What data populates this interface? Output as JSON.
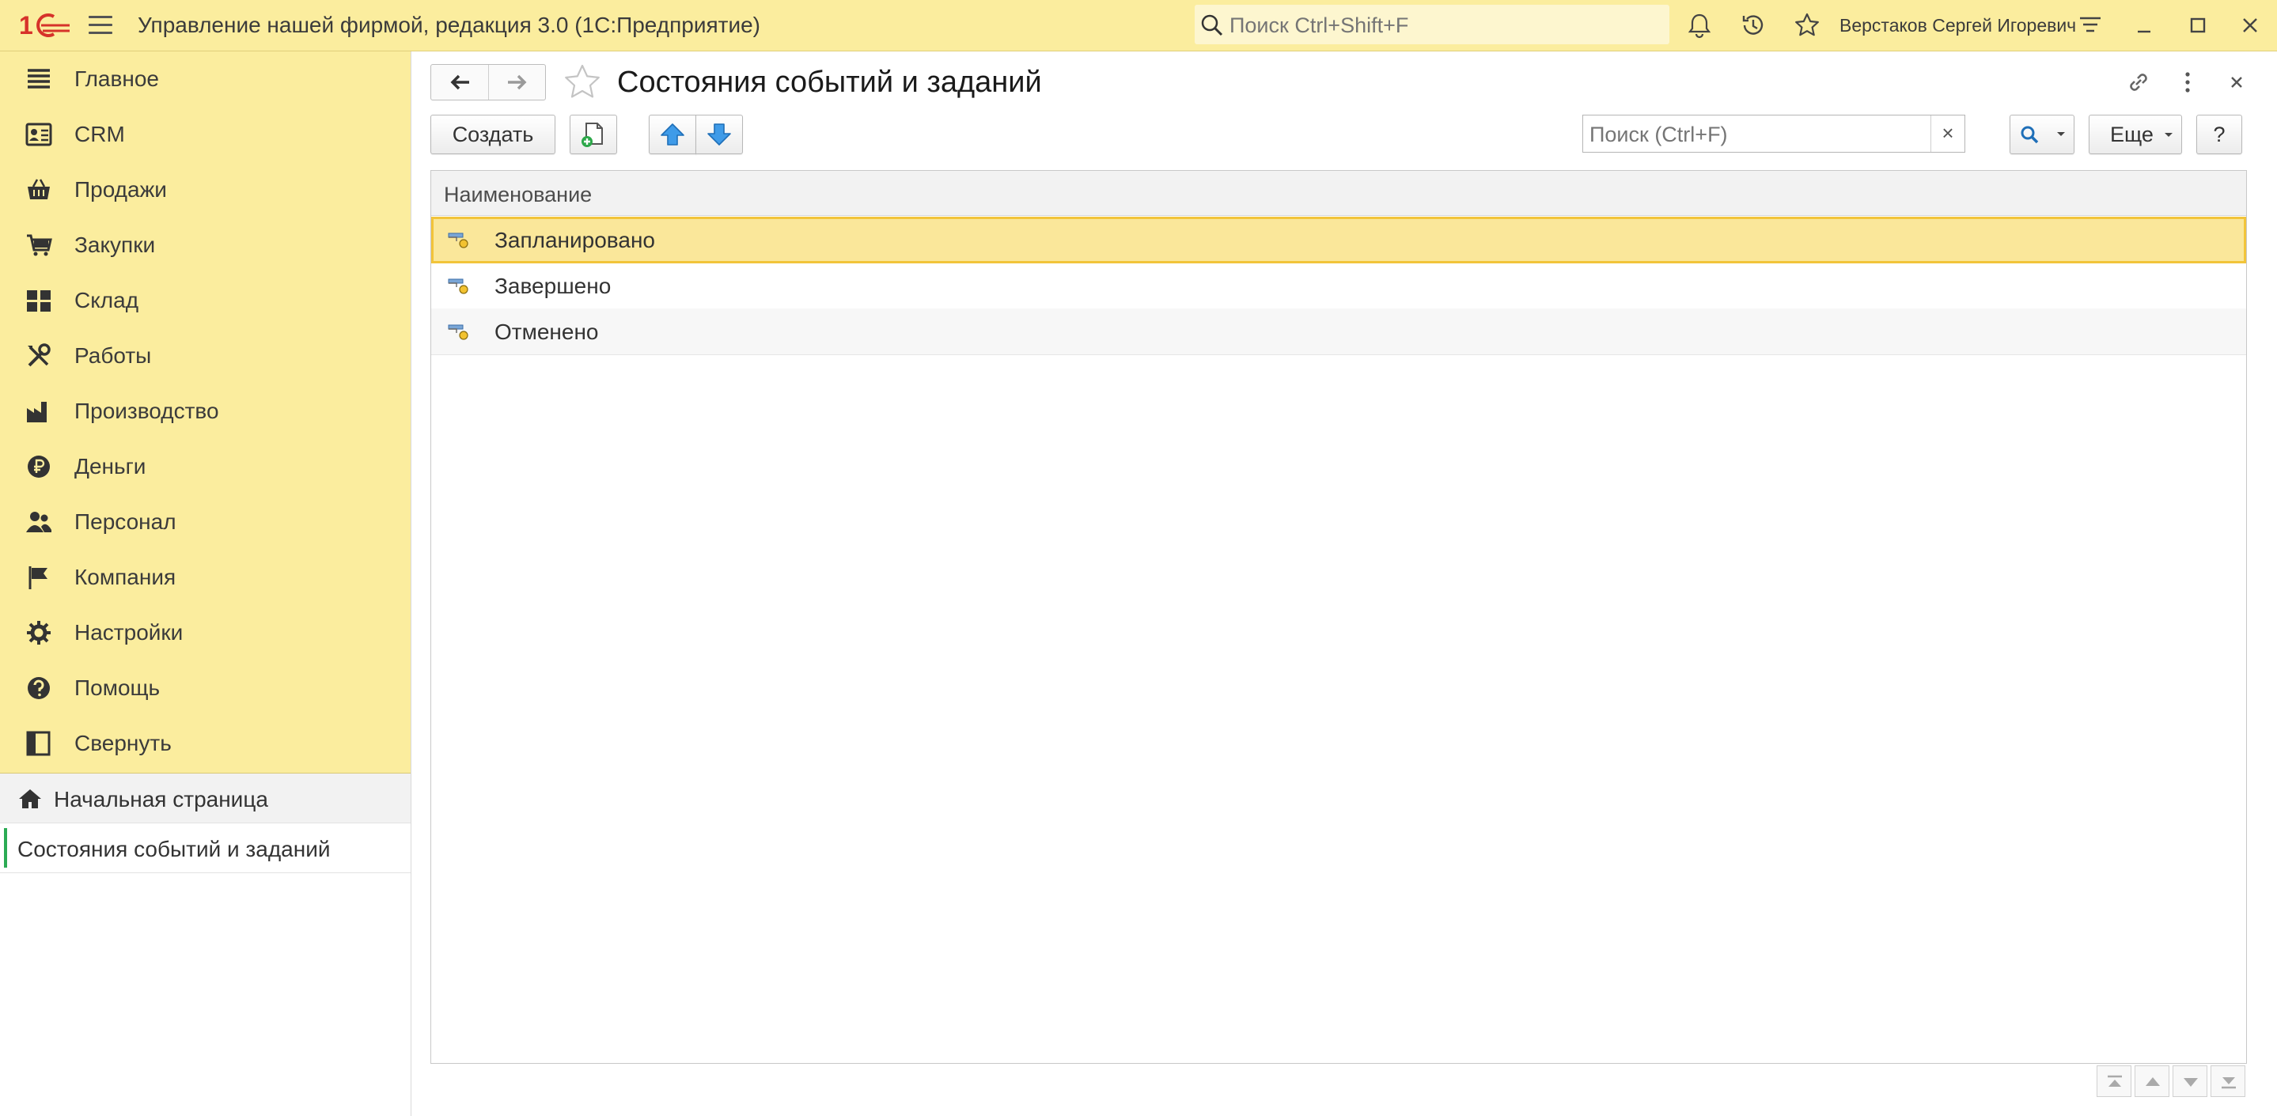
{
  "window": {
    "app_title": "Управление нашей фирмой, редакция 3.0  (1С:Предприятие)",
    "search_placeholder": "Поиск Ctrl+Shift+F",
    "user_name": "Верстаков Сергей Игоревич"
  },
  "sidebar": {
    "sections": [
      {
        "label": "Главное",
        "icon": "main-menu-icon"
      },
      {
        "label": "CRM",
        "icon": "crm-card-icon"
      },
      {
        "label": "Продажи",
        "icon": "sales-basket-icon"
      },
      {
        "label": "Закупки",
        "icon": "purchases-cart-icon"
      },
      {
        "label": "Склад",
        "icon": "warehouse-grid-icon"
      },
      {
        "label": "Работы",
        "icon": "tools-icon"
      },
      {
        "label": "Производство",
        "icon": "factory-icon"
      },
      {
        "label": "Деньги",
        "icon": "ruble-icon"
      },
      {
        "label": "Персонал",
        "icon": "people-icon"
      },
      {
        "label": "Компания",
        "icon": "flag-icon"
      },
      {
        "label": "Настройки",
        "icon": "gear-icon"
      },
      {
        "label": "Помощь",
        "icon": "help-icon"
      },
      {
        "label": "Свернуть",
        "icon": "collapse-panel-icon"
      }
    ],
    "open_windows": [
      {
        "label": "Начальная страница",
        "icon": "home-icon"
      },
      {
        "label": "Состояния событий и заданий"
      }
    ]
  },
  "form": {
    "title": "Состояния событий и заданий",
    "toolbar": {
      "create_label": "Создать",
      "search_placeholder": "Поиск (Ctrl+F)",
      "clear_label": "×",
      "more_label": "Еще",
      "help_label": "?"
    },
    "table": {
      "column_header": "Наименование",
      "rows": [
        "Запланировано",
        "Завершено",
        "Отменено"
      ],
      "selected_index": 0
    }
  },
  "colors": {
    "panel_yellow": "#fbed9e",
    "selection_fill": "#fae79a",
    "selection_border": "#f2c43a",
    "active_marker": "#2bab54",
    "logo_red": "#d6322a"
  }
}
